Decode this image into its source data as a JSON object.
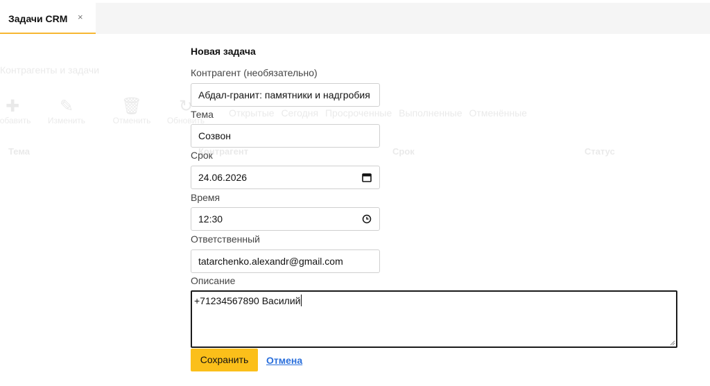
{
  "tabs": [
    {
      "label": "Задачи CRM",
      "close_glyph": "×"
    }
  ],
  "background": {
    "title": "Контрагенты и задачи",
    "toolbar": [
      {
        "label": "Добавить",
        "icon": "plus-icon"
      },
      {
        "label": "Изменить",
        "icon": "pencil-icon"
      },
      {
        "label": "Отменить",
        "icon": "trash-icon"
      },
      {
        "label": "Обновить",
        "icon": "refresh-icon"
      }
    ],
    "filters": [
      "Открытые",
      "Сегодня",
      "Просроченные",
      "Выполненные",
      "Отменённые"
    ],
    "columns": [
      "Тема",
      "Контрагент",
      "Срок",
      "Статус"
    ]
  },
  "form": {
    "title": "Новая задача",
    "contractor": {
      "label": "Контрагент (необязательно)",
      "value": "Абдал-гранит: памятники и надгробия"
    },
    "subject": {
      "label": "Тема",
      "value": "Созвон"
    },
    "deadline": {
      "label": "Срок",
      "value": "24.06.2026",
      "icon": "calendar-icon"
    },
    "time": {
      "label": "Время",
      "value": "12:30",
      "icon": "clock-icon"
    },
    "responsible": {
      "label": "Ответственный",
      "value": "tatarchenko.alexandr@gmail.com"
    },
    "description": {
      "label": "Описание",
      "value": "+71234567890 Василий"
    },
    "save_label": "Сохранить",
    "cancel_label": "Отмена"
  },
  "colors": {
    "accent": "#fbbf1a",
    "link": "#2a6fdb",
    "tab_underline": "#f7b731"
  }
}
